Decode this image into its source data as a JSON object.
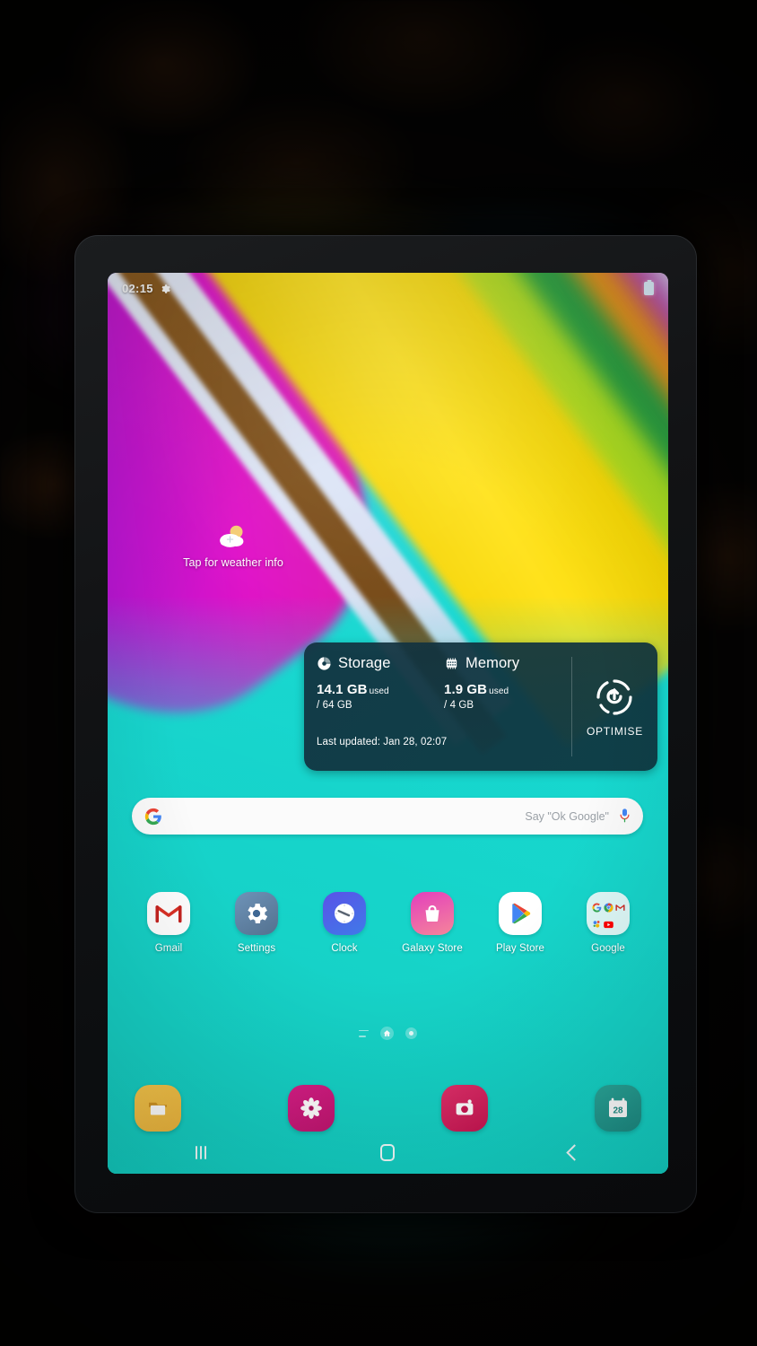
{
  "status_bar": {
    "time": "02:15",
    "gear_icon": "gear-icon",
    "battery_icon": "battery-icon"
  },
  "weather_widget": {
    "icon": "sun-cloud-icon",
    "text": "Tap for weather info"
  },
  "device_care_widget": {
    "storage": {
      "icon": "storage-pie-icon",
      "label": "Storage",
      "used_value": "14.1 GB",
      "used_suffix": "used",
      "total": "/ 64 GB"
    },
    "memory": {
      "icon": "memory-chip-icon",
      "label": "Memory",
      "used_value": "1.9 GB",
      "used_suffix": "used",
      "total": "/ 4 GB"
    },
    "last_updated": "Last updated: Jan 28, 02:07",
    "optimise": {
      "icon": "optimise-refresh-icon",
      "label": "OPTIMISE"
    }
  },
  "search_bar": {
    "logo_icon": "google-g-icon",
    "placeholder": "Say \"Ok Google\"",
    "value": "",
    "mic_icon": "microphone-icon"
  },
  "app_grid": [
    {
      "label": "Gmail",
      "icon": "gmail-icon"
    },
    {
      "label": "Settings",
      "icon": "settings-gear-icon"
    },
    {
      "label": "Clock",
      "icon": "clock-icon"
    },
    {
      "label": "Galaxy Store",
      "icon": "galaxy-store-bag-icon"
    },
    {
      "label": "Play Store",
      "icon": "play-store-icon"
    },
    {
      "label": "Google",
      "icon": "google-folder-icon"
    }
  ],
  "page_indicator": {
    "items": [
      "apps-list-indicator",
      "home-page-indicator",
      "page-dot-indicator"
    ],
    "active_index": 1
  },
  "dock": [
    {
      "name": "My Files",
      "icon": "folder-icon"
    },
    {
      "name": "Gallery",
      "icon": "flower-gallery-icon"
    },
    {
      "name": "Camera",
      "icon": "camera-icon"
    },
    {
      "name": "Calendar",
      "icon": "calendar-icon",
      "day": "28"
    }
  ],
  "navigation_bar": [
    {
      "name": "Recents",
      "icon": "recents-icon"
    },
    {
      "name": "Home",
      "icon": "home-icon"
    },
    {
      "name": "Back",
      "icon": "back-icon"
    }
  ],
  "colors": {
    "wallpaper_teal": "#17dbd0",
    "widget_bg": "#123a4a",
    "accent_magenta": "#e012c8",
    "accent_yellow": "#ffe21a"
  }
}
